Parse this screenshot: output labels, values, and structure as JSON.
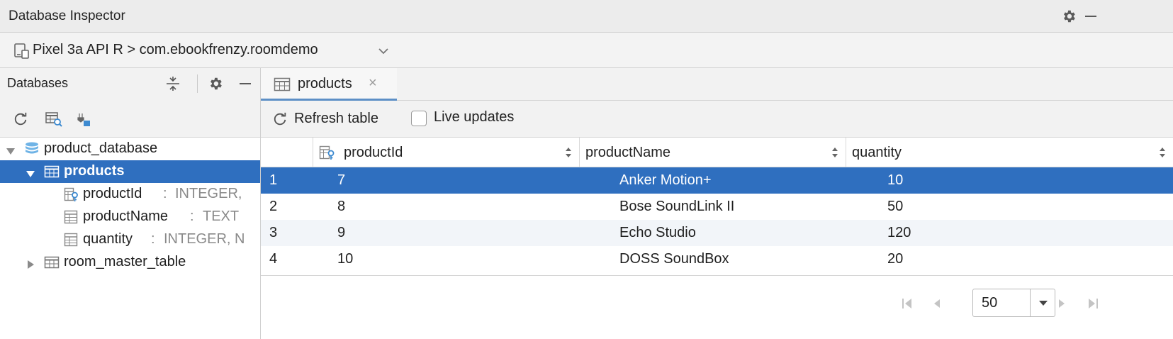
{
  "window": {
    "title": "Database Inspector"
  },
  "device_bar": {
    "device": "Pixel 3a API R",
    "separator": ">",
    "process": "com.ebookfrenzy.roomdemo"
  },
  "databases_panel": {
    "title": "Databases",
    "tree": [
      {
        "name": "product_database",
        "kind": "database",
        "expanded": true
      },
      {
        "name": "products",
        "kind": "table",
        "expanded": true,
        "selected": true
      },
      {
        "name": "productId",
        "kind": "column-pk",
        "type": "INTEGER,",
        "colon": ":"
      },
      {
        "name": "productName",
        "kind": "column",
        "type": "TEXT",
        "colon": ":"
      },
      {
        "name": "quantity",
        "kind": "column",
        "type": "INTEGER, N",
        "colon": ":"
      },
      {
        "name": "room_master_table",
        "kind": "table",
        "expanded": false
      }
    ]
  },
  "tabs": [
    {
      "label": "products",
      "close": "×"
    }
  ],
  "toolbar": {
    "refresh_label": "Refresh table",
    "live_updates_label": "Live updates",
    "live_updates_checked": false
  },
  "grid": {
    "columns": [
      "productId",
      "productName",
      "quantity"
    ],
    "rows": [
      {
        "index": "1",
        "productId": "7",
        "productName": "Anker Motion+",
        "quantity": "10",
        "selected": true
      },
      {
        "index": "2",
        "productId": "8",
        "productName": "Bose SoundLink II",
        "quantity": "50"
      },
      {
        "index": "3",
        "productId": "9",
        "productName": "Echo Studio",
        "quantity": "120"
      },
      {
        "index": "4",
        "productId": "10",
        "productName": "DOSS SoundBox",
        "quantity": "20"
      }
    ]
  },
  "pagination": {
    "page_size": "50"
  },
  "colors": {
    "selection": "#2f6fbf",
    "accent_tab": "#5d8fc6",
    "icon_blue": "#3d8ad0",
    "db_icon": "#6fb3e6"
  },
  "icons": {
    "settings": "gear-icon",
    "minimize": "minimize-icon",
    "device": "device-icon",
    "collapse_all": "collapse-all-icon",
    "refresh": "refresh-icon",
    "run_query": "table-query-icon",
    "keep_connection": "keep-connection-icon",
    "first_page": "first-page-icon",
    "prev_page": "previous-page-icon",
    "next_page": "next-page-icon",
    "last_page": "last-page-icon"
  }
}
